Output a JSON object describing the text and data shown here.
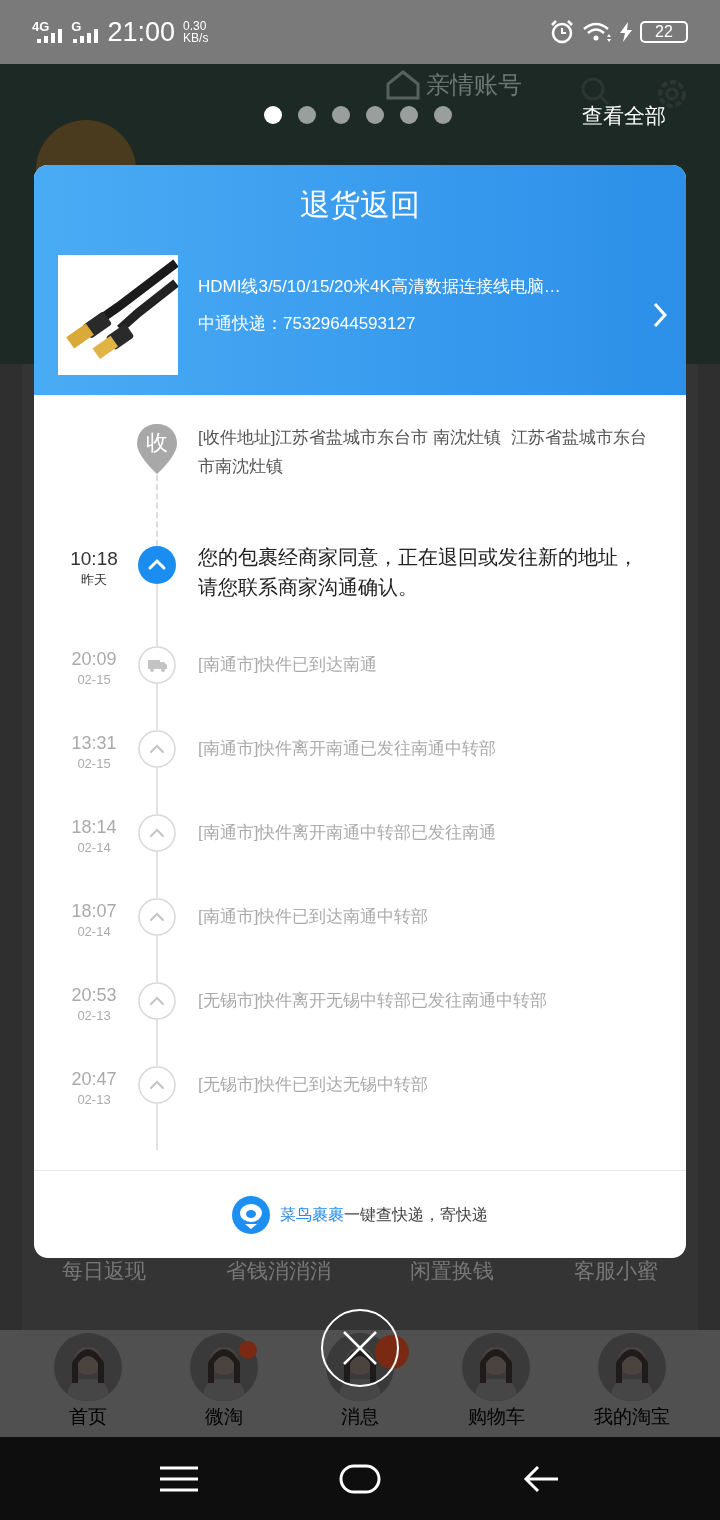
{
  "status_bar": {
    "network_1": "4G",
    "network_2": "G",
    "time": "21:00",
    "speed_value": "0.30",
    "speed_unit": "KB/s",
    "battery": "22"
  },
  "background": {
    "family_account": "亲情账号",
    "features": [
      "每日返现",
      "省钱消消消",
      "闲置换钱",
      "客服小蜜"
    ],
    "tabs": [
      {
        "label": "首页",
        "badge": false
      },
      {
        "label": "微淘",
        "badge": true
      },
      {
        "label": "消息",
        "badge": true
      },
      {
        "label": "购物车",
        "badge": false
      },
      {
        "label": "我的淘宝",
        "badge": false
      }
    ]
  },
  "carousel": {
    "dots": [
      {
        "selected": true
      },
      {
        "selected": false
      },
      {
        "selected": false
      },
      {
        "selected": false
      },
      {
        "selected": false
      },
      {
        "selected": false
      }
    ],
    "view_all": "查看全部"
  },
  "card": {
    "title": "退货返回",
    "product": {
      "title": "HDMI线3/5/10/15/20米4K高清数据连接线电脑…",
      "courier": "中通快递：75329644593127"
    },
    "timeline": [
      {
        "kind": "address",
        "marker": "收",
        "text": "[收件地址]江苏省盐城市东台市 南沈灶镇  江苏省盐城市东台市南沈灶镇"
      },
      {
        "kind": "current",
        "time": "10:18",
        "date": "昨天",
        "text": "您的包裹经商家同意，正在退回或发往新的地址，请您联系商家沟通确认。"
      },
      {
        "kind": "transit",
        "time": "20:09",
        "date": "02-15",
        "text": "[南通市]快件已到达南通"
      },
      {
        "kind": "normal",
        "time": "13:31",
        "date": "02-15",
        "text": "[南通市]快件离开南通已发往南通中转部"
      },
      {
        "kind": "normal",
        "time": "18:14",
        "date": "02-14",
        "text": "[南通市]快件离开南通中转部已发往南通"
      },
      {
        "kind": "normal",
        "time": "18:07",
        "date": "02-14",
        "text": "[南通市]快件已到达南通中转部"
      },
      {
        "kind": "normal",
        "time": "20:53",
        "date": "02-13",
        "text": "[无锡市]快件离开无锡中转部已发往南通中转部"
      },
      {
        "kind": "normal",
        "time": "20:47",
        "date": "02-13",
        "text": "[无锡市]快件已到达无锡中转部"
      }
    ],
    "footer": {
      "brand": "菜鸟裹裹",
      "text": "一键查快递，寄快递"
    }
  }
}
